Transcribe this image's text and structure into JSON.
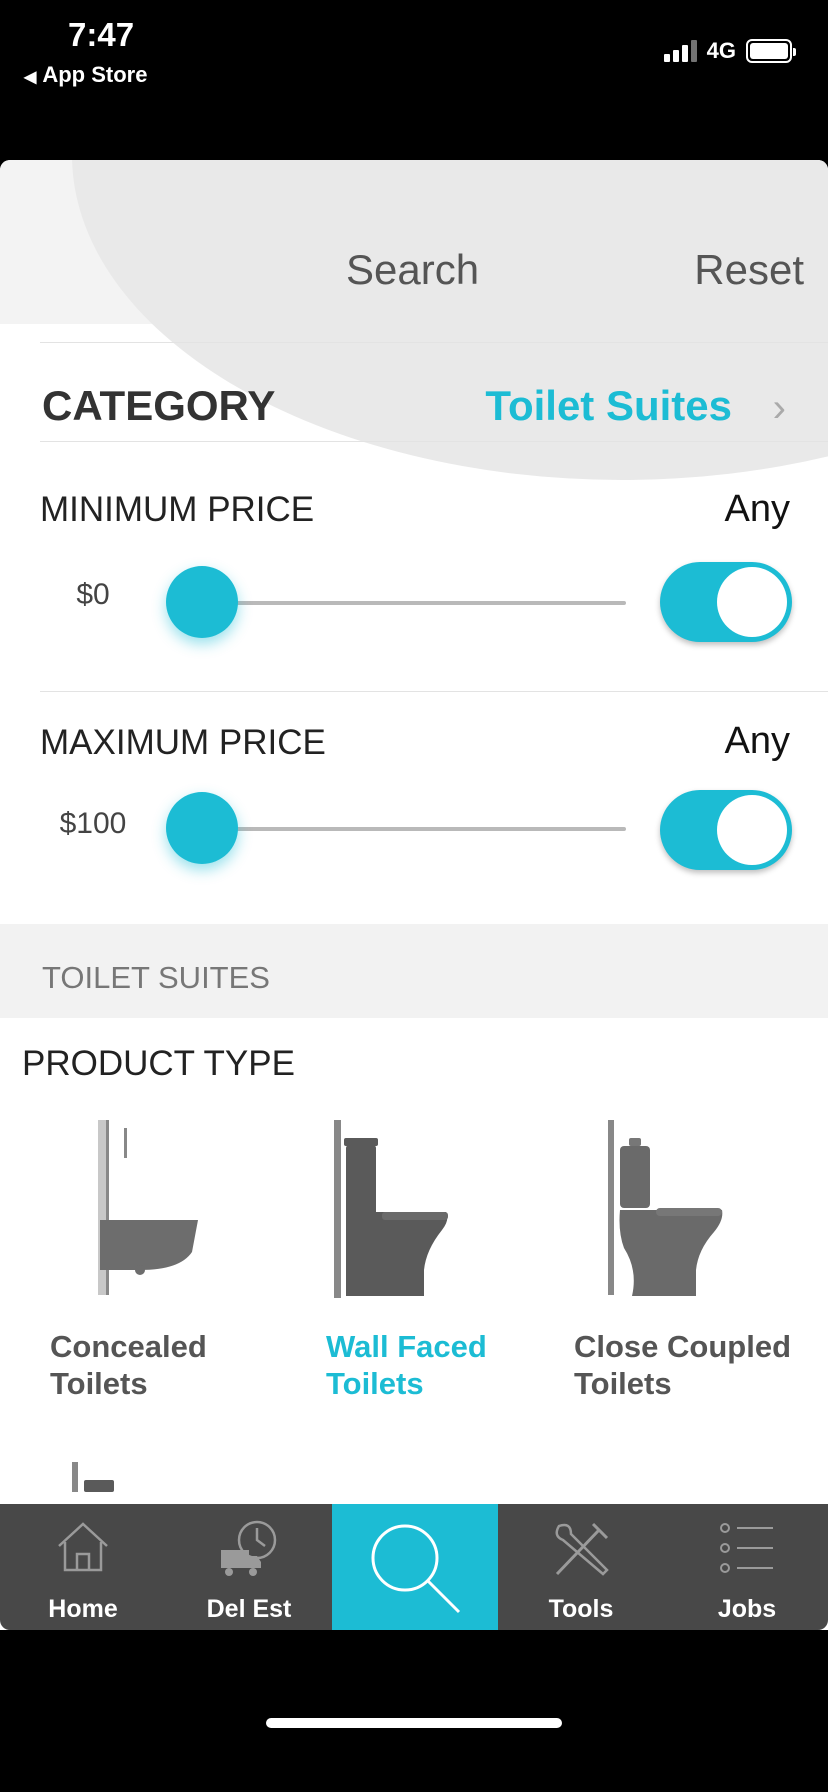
{
  "status_bar": {
    "time": "7:47",
    "back_label": "App Store",
    "network": "4G"
  },
  "header": {
    "search_label": "Search",
    "reset_label": "Reset"
  },
  "category": {
    "label": "CATEGORY",
    "value": "Toilet Suites"
  },
  "min_price": {
    "label": "MINIMUM PRICE",
    "any_label": "Any",
    "value": "$0",
    "slider_fraction": 0.0,
    "toggle_on": true
  },
  "max_price": {
    "label": "MAXIMUM PRICE",
    "any_label": "Any",
    "value": "$100",
    "slider_fraction": 0.0,
    "toggle_on": true
  },
  "section": {
    "title": "TOILET SUITES",
    "product_type_label": "PRODUCT TYPE"
  },
  "products": [
    {
      "line1": "Concealed",
      "line2": "Toilets",
      "selected": false,
      "icon": "concealed-toilet-icon"
    },
    {
      "line1": "Wall Faced",
      "line2": "Toilets",
      "selected": true,
      "icon": "wall-faced-toilet-icon"
    },
    {
      "line1": "Close Coupled",
      "line2": "Toilets",
      "selected": false,
      "icon": "close-coupled-toilet-icon"
    }
  ],
  "tabs": [
    {
      "label": "Home",
      "icon": "home-icon"
    },
    {
      "label": "Del Est",
      "icon": "delivery-clock-icon"
    },
    {
      "label": "",
      "icon": "search-icon",
      "active": true
    },
    {
      "label": "Tools",
      "icon": "tools-icon"
    },
    {
      "label": "Jobs",
      "icon": "list-icon"
    }
  ],
  "colors": {
    "accent": "#1cbcd4",
    "tabbar": "#484848",
    "text_dark": "#333333"
  }
}
